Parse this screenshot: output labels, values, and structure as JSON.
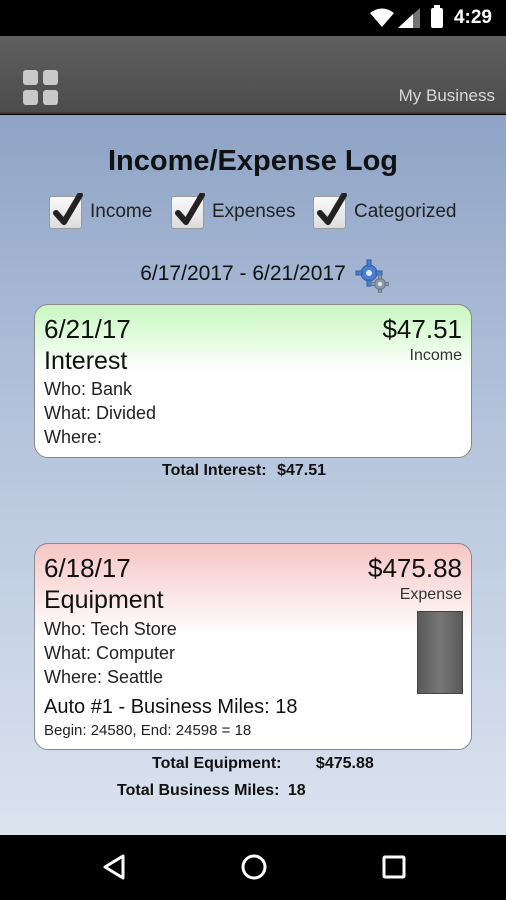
{
  "status_bar": {
    "time": "4:29",
    "icons": [
      "wifi-icon",
      "cell-signal-icon",
      "battery-icon"
    ]
  },
  "app_bar": {
    "menu_icon": "grid-menu-icon",
    "title": "My Business"
  },
  "page": {
    "title": "Income/Expense Log",
    "filters": [
      {
        "label": "Income",
        "checked": true
      },
      {
        "label": "Expenses",
        "checked": true
      },
      {
        "label": "Categorized",
        "checked": true
      }
    ],
    "date_range": "6/17/2017 - 6/21/2017",
    "settings_icon": "gear-icon"
  },
  "entries": [
    {
      "date": "6/21/17",
      "amount": "$47.51",
      "kind": "Income",
      "category": "Interest",
      "who": "Who: Bank",
      "what": "What: Divided",
      "where": "Where:",
      "color": "#c8f7c0"
    },
    {
      "date": "6/18/17",
      "amount": "$475.88",
      "kind": "Expense",
      "category": "Equipment",
      "who": "Who: Tech Store",
      "what": "What: Computer",
      "where": "Where: Seattle",
      "auto": "Auto #1 - Business Miles: 18",
      "odometer": "Begin: 24580, End: 24598 = 18",
      "color": "#f6c5c5"
    }
  ],
  "totals": {
    "interest_label": "Total Interest:",
    "interest_value": "$47.51",
    "equipment_label": "Total Equipment:",
    "equipment_value": "$475.88",
    "miles_label": "Total Business Miles:",
    "miles_value": "18"
  },
  "nav_bar": {
    "buttons": [
      "back-icon",
      "home-icon",
      "recents-icon"
    ]
  }
}
